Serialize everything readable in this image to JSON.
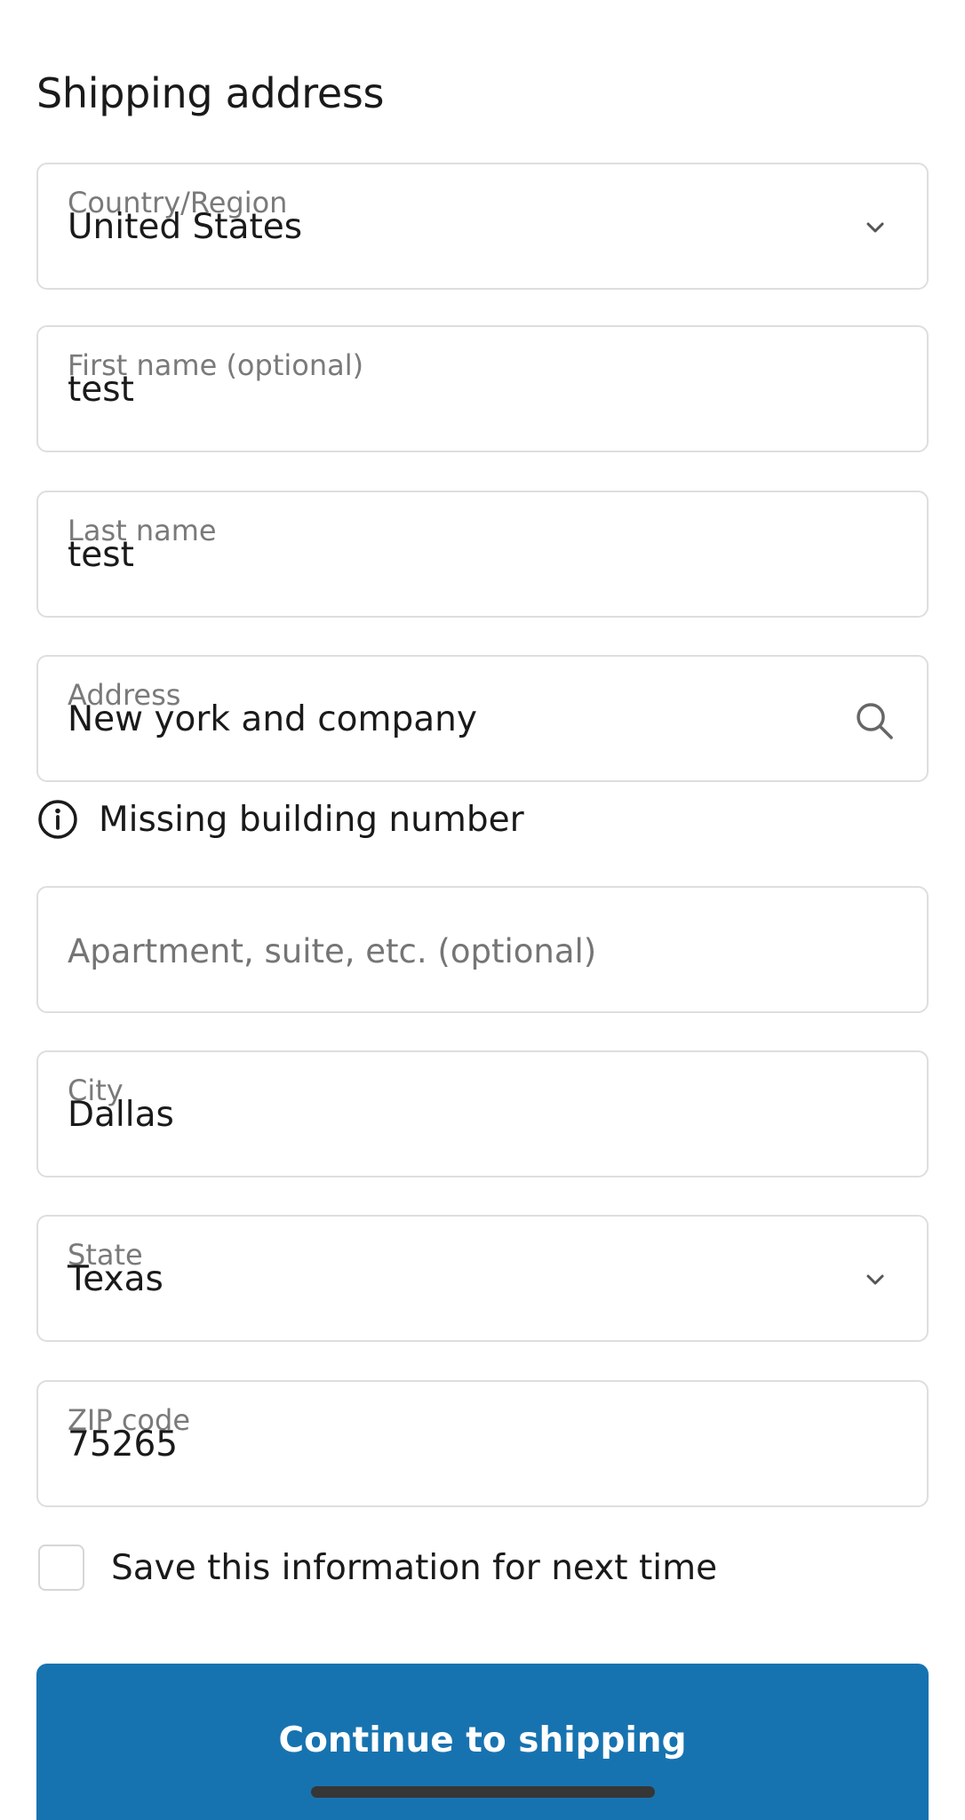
{
  "page": {
    "title": "Shipping address"
  },
  "fields": {
    "country": {
      "label": "Country/Region",
      "value": "United States",
      "icon": "chevron-down-icon"
    },
    "first_name": {
      "label": "First name (optional)",
      "value": "test"
    },
    "last_name": {
      "label": "Last name",
      "value": "test"
    },
    "address": {
      "label": "Address",
      "value": "New york and company",
      "icon": "search-icon"
    },
    "apartment": {
      "placeholder": "Apartment, suite, etc. (optional)"
    },
    "city": {
      "label": "City",
      "value": "Dallas"
    },
    "state": {
      "label": "State",
      "value": "Texas",
      "icon": "chevron-down-icon"
    },
    "zip": {
      "label": "ZIP code",
      "value": "75265"
    }
  },
  "address_hint": {
    "icon": "info-icon",
    "text": "Missing building number"
  },
  "save_info": {
    "label": "Save this information for next time",
    "checked": false
  },
  "actions": {
    "continue_label": "Continue to shipping"
  },
  "colors": {
    "primary_button": "#1773b0",
    "field_border": "#dedede",
    "label_text": "#7a7a7a",
    "body_text": "#1a1a1a"
  }
}
